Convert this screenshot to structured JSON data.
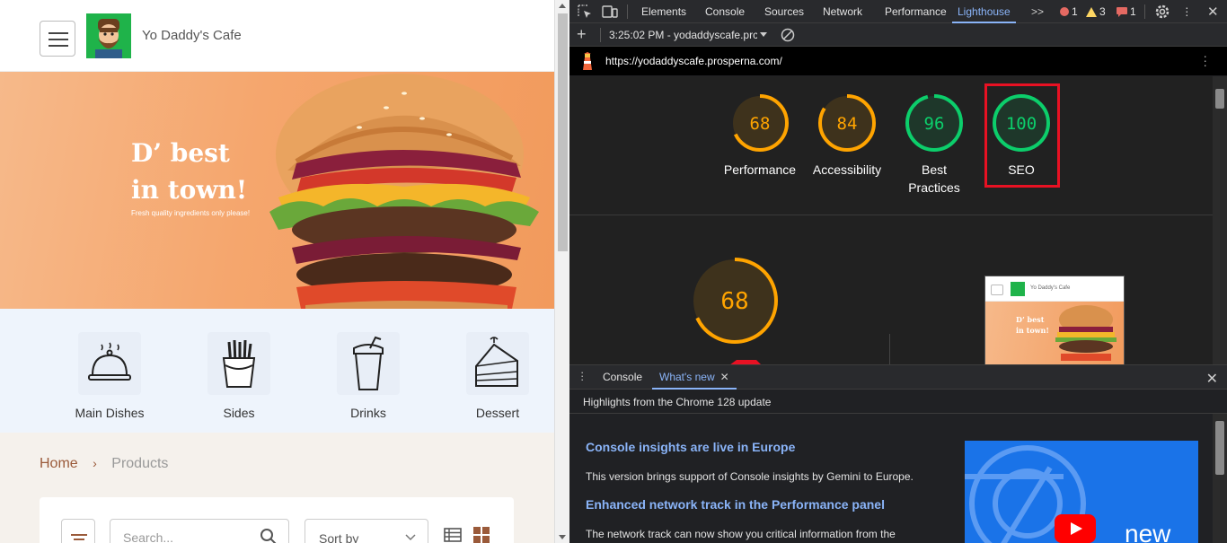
{
  "site": {
    "name": "Yo Daddy's Cafe",
    "hero": {
      "title_line1": "D’ best",
      "title_line2": "in town!",
      "subtitle": "Fresh quality ingredients only please!"
    },
    "categories": [
      {
        "label": "Main Dishes",
        "icon": "cloche-icon"
      },
      {
        "label": "Sides",
        "icon": "fries-icon"
      },
      {
        "label": "Drinks",
        "icon": "drink-cup-icon"
      },
      {
        "label": "Dessert",
        "icon": "cake-slice-icon"
      }
    ],
    "breadcrumb": {
      "home": "Home",
      "separator": "›",
      "current": "Products"
    },
    "search": {
      "placeholder": "Search..."
    },
    "sort": {
      "label": "Sort by"
    }
  },
  "devtools": {
    "tabs": [
      "Elements",
      "Console",
      "Sources",
      "Network",
      "Performance",
      "Lighthouse"
    ],
    "active_tab": "Lighthouse",
    "more": ">>",
    "badges": {
      "errors": "1",
      "warnings": "3",
      "issues": "1"
    },
    "report_label": "3:25:02 PM - yodaddyscafe.prc",
    "url": "https://yodaddyscafe.prosperna.com/",
    "scores": [
      {
        "label": "Performance",
        "value": "68",
        "fraction": 0.68,
        "color": "#ffa400"
      },
      {
        "label": "Accessibility",
        "value": "84",
        "fraction": 0.84,
        "color": "#ffa400"
      },
      {
        "label": "Best Practices",
        "value": "96",
        "fraction": 0.96,
        "color": "#0cce6b"
      },
      {
        "label": "SEO",
        "value": "100",
        "fraction": 1.0,
        "color": "#0cce6b"
      }
    ],
    "main_score": {
      "value": "68",
      "fraction": 0.68,
      "color": "#ffa400"
    },
    "thumbnail": {
      "site_name": "Yo Daddy's Cafe",
      "title_line1": "D’ best",
      "title_line2": "in town!"
    },
    "drawer": {
      "tabs": [
        "Console",
        "What's new"
      ],
      "active": "What's new",
      "header": "Highlights from the Chrome 128 update",
      "items": [
        {
          "title": "Console insights are live in Europe",
          "text": "This version brings support of Console insights by Gemini to Europe."
        },
        {
          "title": "Enhanced network track in the Performance panel",
          "text": "The network track can now show you critical information from the"
        }
      ],
      "video_label": "new"
    }
  }
}
